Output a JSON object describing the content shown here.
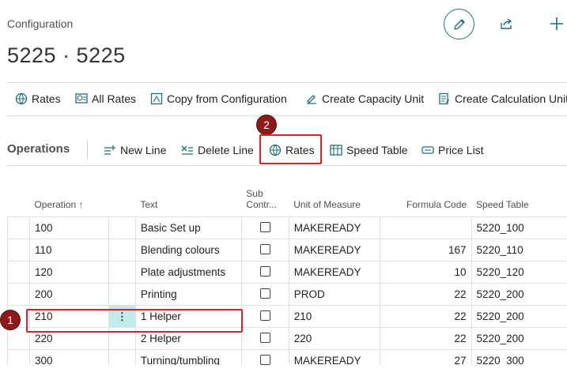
{
  "header": {
    "caption": "Configuration",
    "title": "5225 · 5225"
  },
  "top_actions": [
    {
      "label": "Rates",
      "icon": "globe-rates-icon"
    },
    {
      "label": "All Rates",
      "icon": "all-rates-icon"
    },
    {
      "label": "Copy from Configuration",
      "icon": "copy-icon"
    },
    {
      "label": "Create Capacity Unit",
      "icon": "create-capacity-icon"
    },
    {
      "label": "Create Calculation Unit",
      "icon": "create-calculation-icon"
    }
  ],
  "operations": {
    "title": "Operations",
    "actions": [
      {
        "label": "New Line",
        "icon": "new-line-icon"
      },
      {
        "label": "Delete Line",
        "icon": "delete-line-icon"
      },
      {
        "label": "Rates",
        "icon": "globe-rates-icon"
      },
      {
        "label": "Speed Table",
        "icon": "speed-table-icon"
      },
      {
        "label": "Price List",
        "icon": "price-list-icon"
      }
    ]
  },
  "callouts": {
    "one": "1",
    "two": "2"
  },
  "table": {
    "columns": {
      "operation": "Operation ↑",
      "text": "Text",
      "sub_line1": "Sub",
      "sub_line2": "Contr...",
      "uom": "Unit of Measure",
      "formula": "Formula Code",
      "speed": "Speed Table"
    },
    "rows": [
      {
        "operation": "100",
        "text": "Basic Set up",
        "uom": "MAKEREADY",
        "formula": "",
        "speed": "5220_100"
      },
      {
        "operation": "110",
        "text": "Blending colours",
        "uom": "MAKEREADY",
        "formula": "167",
        "speed": "5220_110"
      },
      {
        "operation": "120",
        "text": "Plate adjustments",
        "uom": "MAKEREADY",
        "formula": "10",
        "speed": "5220_120"
      },
      {
        "operation": "200",
        "text": "Printing",
        "uom": "PROD",
        "formula": "22",
        "speed": "5220_200"
      },
      {
        "operation": "210",
        "text": "1 Helper",
        "uom": "210",
        "formula": "22",
        "speed": "5220_200"
      },
      {
        "operation": "220",
        "text": "2 Helper",
        "uom": "220",
        "formula": "22",
        "speed": "5220_200"
      },
      {
        "operation": "300",
        "text": "Turning/tumbling",
        "uom": "MAKEREADY",
        "formula": "27",
        "speed": "5220_300"
      }
    ]
  },
  "colors": {
    "accent": "#1f6f7a",
    "highlight": "#d8232a",
    "badge": "#8b1b1b",
    "selected_cell": "#c2ebec"
  }
}
